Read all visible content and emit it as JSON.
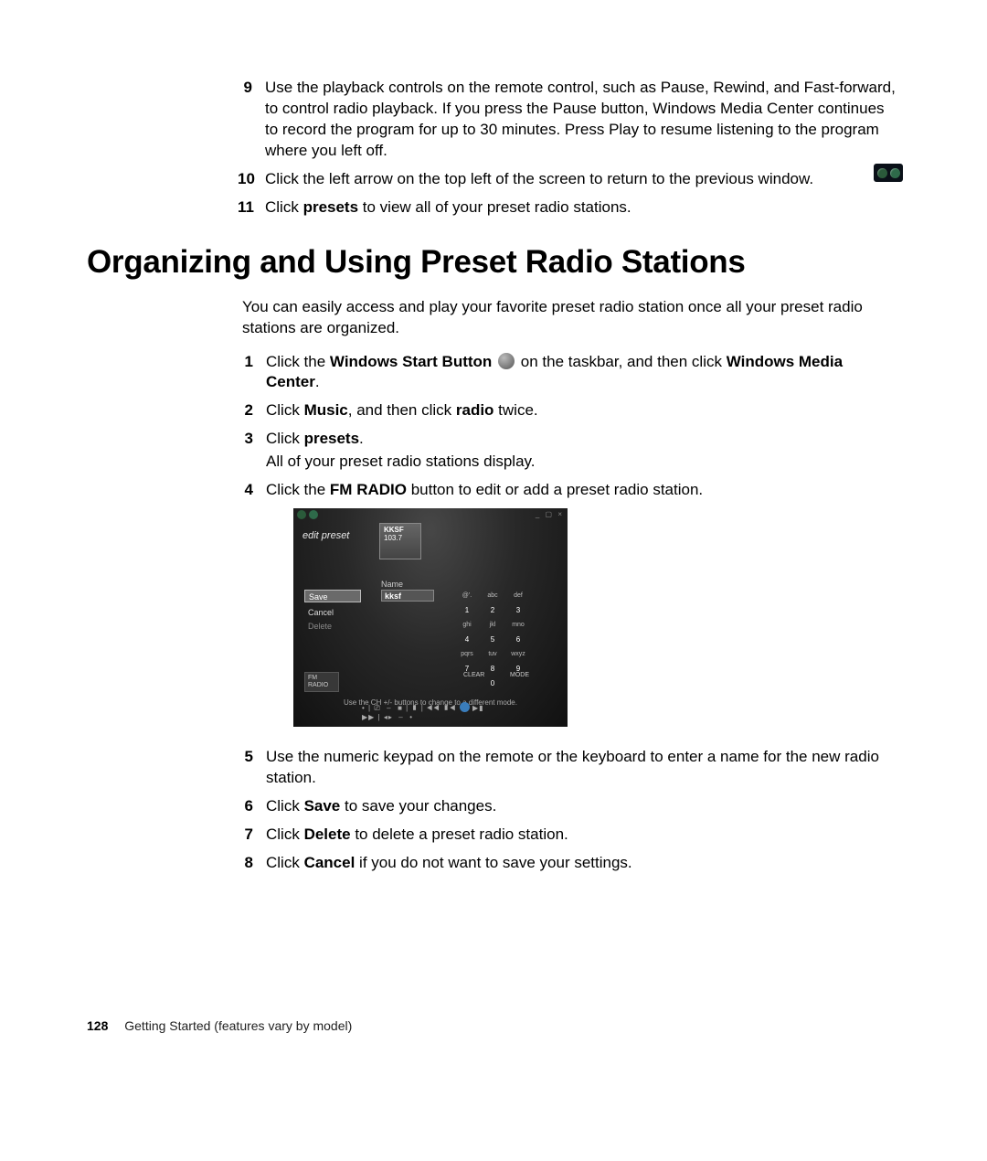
{
  "topList": {
    "i9": {
      "num": "9",
      "text": "Use the playback controls on the remote control, such as Pause, Rewind, and Fast-forward, to control radio playback. If you press the Pause button, Windows Media Center continues to record the program for up to 30 minutes. Press Play to resume listening to the program where you left off."
    },
    "i10": {
      "num": "10",
      "text": "Click the left arrow on the top left of the screen to return to the previous window."
    },
    "i11": {
      "num": "11",
      "pre": "Click ",
      "bold": "presets",
      "post": " to view all of your preset radio stations."
    }
  },
  "heading": "Organizing and Using Preset Radio Stations",
  "intro": "You can easily access and play your favorite preset radio station once all your preset radio stations are organized.",
  "steps": {
    "s1": {
      "num": "1",
      "p1": "Click the ",
      "b1": "Windows Start Button",
      "p2": " on the taskbar, and then click ",
      "b2": "Windows Media Center",
      "p3": "."
    },
    "s2": {
      "num": "2",
      "p1": "Click ",
      "b1": "Music",
      "p2": ", and then click ",
      "b2": "radio",
      "p3": " twice."
    },
    "s3": {
      "num": "3",
      "p1": "Click ",
      "b1": "presets",
      "p2": ".",
      "sub": "All of your preset radio stations display."
    },
    "s4": {
      "num": "4",
      "p1": "Click the ",
      "b1": "FM RADIO",
      "p2": " button to edit or add a preset radio station."
    },
    "s5": {
      "num": "5",
      "text": "Use the numeric keypad on the remote or the keyboard to enter a name for the new radio station."
    },
    "s6": {
      "num": "6",
      "p1": "Click ",
      "b1": "Save",
      "p2": " to save your changes."
    },
    "s7": {
      "num": "7",
      "p1": "Click ",
      "b1": "Delete",
      "p2": " to delete a preset radio station."
    },
    "s8": {
      "num": "8",
      "p1": "Click ",
      "b1": "Cancel",
      "p2": " if you do not want to save your settings."
    }
  },
  "shot": {
    "edit": "edit preset",
    "tileName": "KKSF",
    "tileFreq": "103.7",
    "nameLabel": "Name",
    "nameValue": "kksf",
    "save": "Save",
    "cancel": "Cancel",
    "delete": "Delete",
    "fm": "FM RADIO",
    "clear": "CLEAR",
    "mode": "MODE",
    "tip": "Use the CH +/- buttons to change to a different mode.",
    "kp": {
      "k1a": "@'.",
      "k1b": "abc",
      "k1c": "def",
      "k1d": "1",
      "k1e": "2",
      "k1f": "3",
      "k2a": "ghi",
      "k2b": "jkl",
      "k2c": "mno",
      "k2d": "4",
      "k2e": "5",
      "k2f": "6",
      "k3a": "pqrs",
      "k3b": "tuv",
      "k3c": "wxyz",
      "k3d": "7",
      "k3e": "8",
      "k3f": "9",
      "k4": "0"
    }
  },
  "footer": {
    "page": "128",
    "text": "Getting Started (features vary by model)"
  }
}
